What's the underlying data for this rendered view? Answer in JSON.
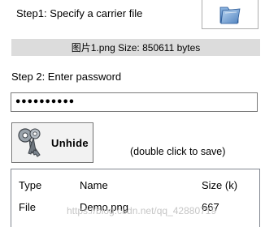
{
  "step1": {
    "label": "Step1: Specify a carrier file"
  },
  "open_button": {
    "icon": "folder-icon"
  },
  "file_info": {
    "text": "图片1.png  Size: 850611 bytes"
  },
  "step2": {
    "label": "Step 2: Enter password"
  },
  "password": {
    "value": "••••••••••"
  },
  "unhide_button": {
    "label": "Unhide",
    "icon": "keys-icon"
  },
  "hint": {
    "text": "(double click to save)"
  },
  "table": {
    "columns": [
      "Type",
      "Name",
      "Size (k)"
    ],
    "rows": [
      {
        "type": "File",
        "name": "Demo.png",
        "size": "667"
      }
    ]
  },
  "watermark": {
    "text": "https://blog.csdn.net/qq_42880719"
  }
}
